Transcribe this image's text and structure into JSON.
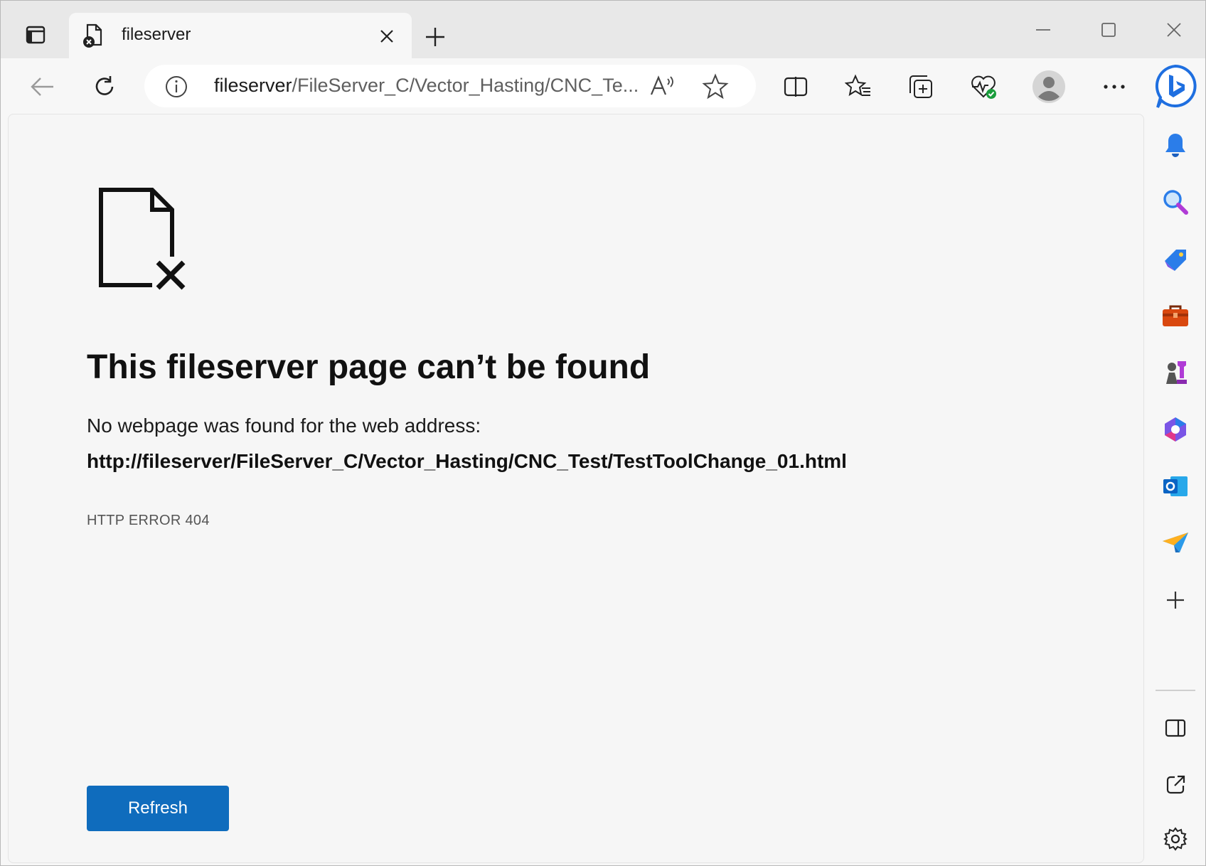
{
  "tab": {
    "title": "fileserver"
  },
  "addressbar": {
    "host": "fileserver",
    "path": "/FileServer_C/Vector_Hasting/CNC_Te..."
  },
  "icons": {
    "tab_actions": "tab-actions-icon",
    "tab_favicon": "page-error-icon",
    "tab_close": "close-icon",
    "new_tab": "plus-icon",
    "minimize": "minimize-icon",
    "maximize": "maximize-icon",
    "close_window": "close-icon",
    "back": "back-arrow-icon",
    "reload": "reload-icon",
    "site_info": "info-icon",
    "read_aloud": "read-aloud-icon",
    "favorite": "star-icon",
    "split_screen": "split-screen-icon",
    "favorites": "favorites-icon",
    "collections": "collections-icon",
    "browser_essentials": "heart-pulse-icon",
    "profile": "profile-avatar-icon",
    "more": "more-icon",
    "copilot": "bing-copilot-icon",
    "sidebar": [
      "bell-icon",
      "search-icon",
      "tag-icon",
      "toolbox-icon",
      "games-icon",
      "office-icon",
      "outlook-icon",
      "drop-icon",
      "plus-icon",
      "sidebar-toggle-icon",
      "open-external-icon",
      "settings-gear-icon"
    ]
  },
  "page": {
    "title": "This fileserver page can’t be found",
    "description": "No webpage was found for the web address:",
    "url": "http://fileserver/FileServer_C/Vector_Hasting/CNC_Test/TestToolChange_01.html",
    "error_code": "HTTP ERROR 404",
    "refresh_label": "Refresh"
  },
  "colors": {
    "accent": "#0f6cbd",
    "page_bg": "#f6f6f6",
    "chrome_bg": "#e8e8e8"
  }
}
